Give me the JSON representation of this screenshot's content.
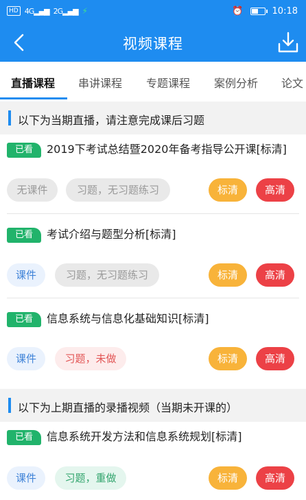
{
  "status_bar": {
    "hd": "HD",
    "net1": "4G",
    "net2": "2G",
    "time": "10:18"
  },
  "app_bar": {
    "title": "视频课程",
    "back_icon": "back-arrow-icon",
    "download_icon": "download-icon"
  },
  "tabs": [
    {
      "label": "直播课程",
      "active": true
    },
    {
      "label": "串讲课程",
      "active": false
    },
    {
      "label": "专题课程",
      "active": false
    },
    {
      "label": "案例分析",
      "active": false
    },
    {
      "label": "论文",
      "active": false
    }
  ],
  "sections": [
    {
      "header": "以下为当期直播，请注意完成课后习题",
      "items": [
        {
          "badge": "已看",
          "title": "2019下考试总结暨2020年备考指导公开课[标清]",
          "courseware": "无课件",
          "exercise": "习题，无习题练习",
          "sd": "标清",
          "hd": "高清"
        },
        {
          "badge": "已看",
          "title": "考试介绍与题型分析[标清]",
          "courseware": "课件",
          "exercise": "习题，无习题练习",
          "sd": "标清",
          "hd": "高清"
        },
        {
          "badge": "已看",
          "title": "信息系统与信息化基础知识[标清]",
          "courseware": "课件",
          "exercise": "习题，未做",
          "sd": "标清",
          "hd": "高清"
        }
      ]
    },
    {
      "header": "以下为上期直播的录播视频（当期未开课的）",
      "items": [
        {
          "badge": "已看",
          "title": "信息系统开发方法和信息系统规划[标清]",
          "courseware": "课件",
          "exercise": "习题，重做",
          "sd": "标清",
          "hd": "高清"
        }
      ]
    }
  ],
  "colors": {
    "primary": "#1e8cf0",
    "seen_badge": "#21b36b",
    "sd_button": "#f8b33a",
    "hd_button": "#ec4146"
  }
}
